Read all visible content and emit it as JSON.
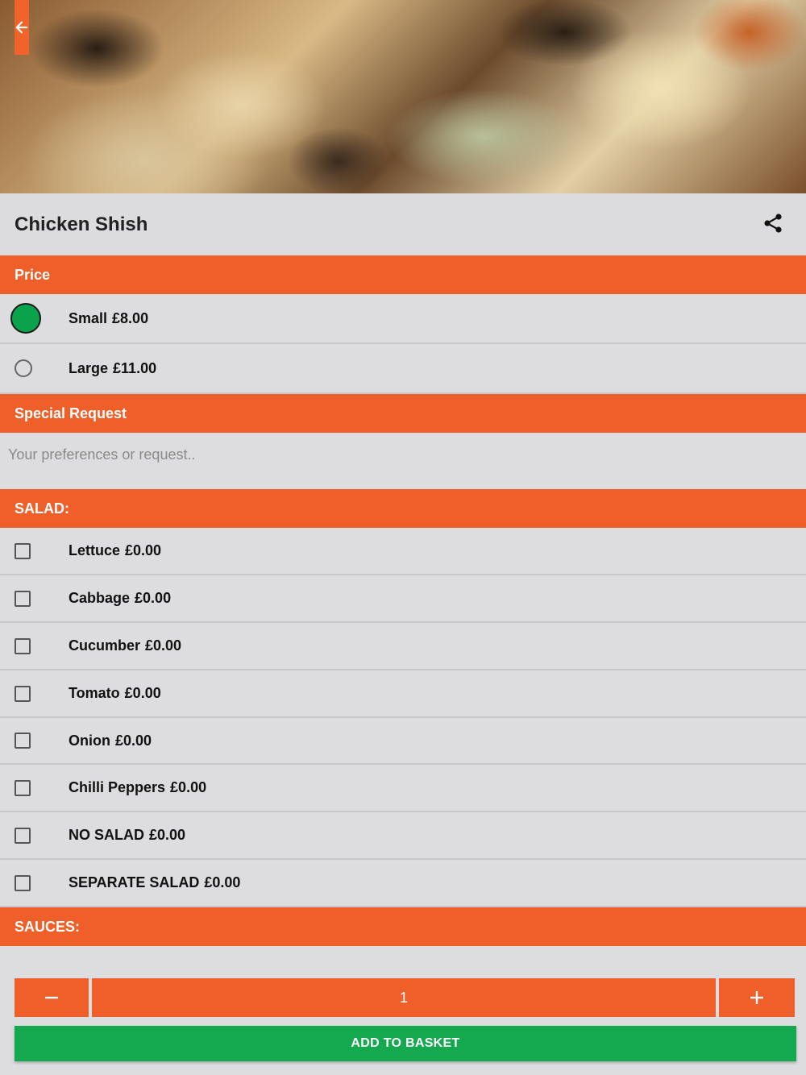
{
  "product": {
    "title": "Chicken Shish"
  },
  "sections": {
    "price": "Price",
    "special_request": "Special Request",
    "salad": "SALAD:",
    "sauces": "SAUCES:"
  },
  "price_options": [
    {
      "name": "Small",
      "price": "£8.00",
      "selected": true
    },
    {
      "name": "Large",
      "price": "£11.00",
      "selected": false
    }
  ],
  "special_request": {
    "placeholder": "Your preferences or request..",
    "value": ""
  },
  "salad_options": [
    {
      "name": "Lettuce",
      "price": "£0.00",
      "checked": false
    },
    {
      "name": "Cabbage",
      "price": "£0.00",
      "checked": false
    },
    {
      "name": "Cucumber",
      "price": "£0.00",
      "checked": false
    },
    {
      "name": "Tomato",
      "price": "£0.00",
      "checked": false
    },
    {
      "name": "Onion",
      "price": "£0.00",
      "checked": false
    },
    {
      "name": "Chilli Peppers",
      "price": "£0.00",
      "checked": false
    },
    {
      "name": "NO SALAD",
      "price": "£0.00",
      "checked": false
    },
    {
      "name": "SEPARATE SALAD",
      "price": "£0.00",
      "checked": false
    }
  ],
  "quantity": {
    "value": "1",
    "minus_symbol": "−",
    "plus_symbol": "+"
  },
  "footer": {
    "add_to_basket": "ADD TO BASKET"
  },
  "colors": {
    "accent": "#ef5f29",
    "confirm": "#14a84f",
    "selected_radio": "#0aa24a",
    "background": "#dddddf"
  },
  "icons": {
    "back": "arrow-left-icon",
    "share": "share-icon",
    "minus": "minus-icon",
    "plus": "plus-icon"
  }
}
